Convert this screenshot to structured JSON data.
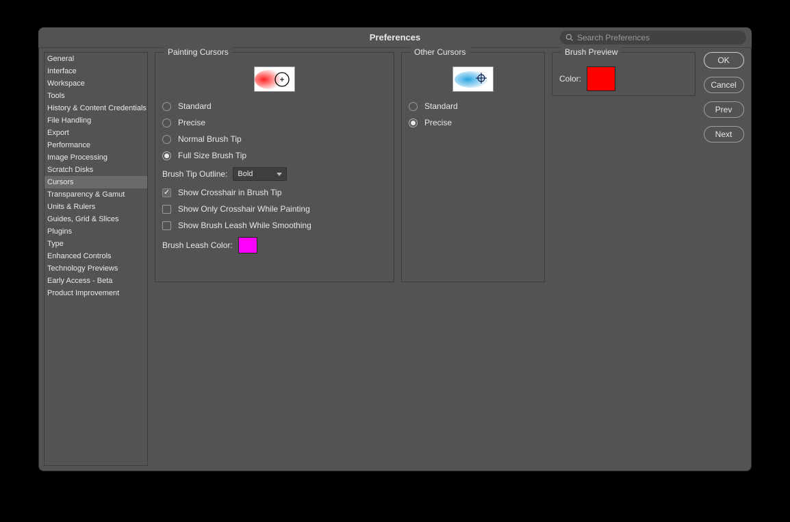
{
  "title": "Preferences",
  "search_placeholder": "Search Preferences",
  "sidebar": {
    "items": [
      {
        "label": "General"
      },
      {
        "label": "Interface"
      },
      {
        "label": "Workspace"
      },
      {
        "label": "Tools"
      },
      {
        "label": "History & Content Credentials"
      },
      {
        "label": "File Handling"
      },
      {
        "label": "Export"
      },
      {
        "label": "Performance"
      },
      {
        "label": "Image Processing"
      },
      {
        "label": "Scratch Disks"
      },
      {
        "label": "Cursors"
      },
      {
        "label": "Transparency & Gamut"
      },
      {
        "label": "Units & Rulers"
      },
      {
        "label": "Guides, Grid & Slices"
      },
      {
        "label": "Plugins"
      },
      {
        "label": "Type"
      },
      {
        "label": "Enhanced Controls"
      },
      {
        "label": "Technology Previews"
      },
      {
        "label": "Early Access - Beta"
      },
      {
        "label": "Product Improvement"
      }
    ],
    "selected_index": 10
  },
  "painting_cursors": {
    "legend": "Painting Cursors",
    "options": [
      "Standard",
      "Precise",
      "Normal Brush Tip",
      "Full Size Brush Tip"
    ],
    "selected_index": 3,
    "brush_tip_outline_label": "Brush Tip Outline:",
    "brush_tip_outline_value": "Bold",
    "show_crosshair_label": "Show Crosshair in Brush Tip",
    "show_crosshair_checked": true,
    "show_only_crosshair_label": "Show Only Crosshair While Painting",
    "show_only_crosshair_checked": false,
    "show_leash_label": "Show Brush Leash While Smoothing",
    "show_leash_checked": false,
    "brush_leash_color_label": "Brush Leash Color:",
    "brush_leash_color": "#ff00ff"
  },
  "other_cursors": {
    "legend": "Other Cursors",
    "options": [
      "Standard",
      "Precise"
    ],
    "selected_index": 1
  },
  "brush_preview": {
    "legend": "Brush Preview",
    "color_label": "Color:",
    "color": "#ff0000"
  },
  "buttons": {
    "ok": "OK",
    "cancel": "Cancel",
    "prev": "Prev",
    "next": "Next"
  }
}
